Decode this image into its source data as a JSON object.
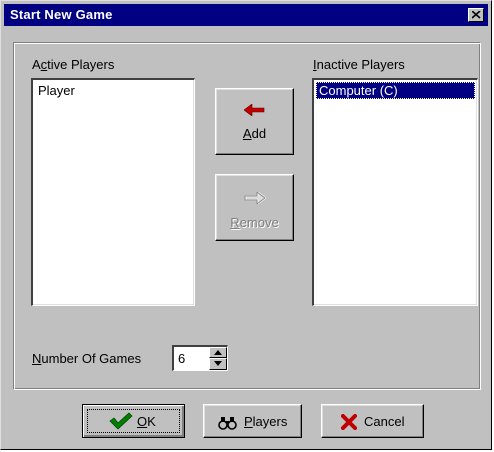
{
  "window": {
    "title": "Start New Game"
  },
  "active": {
    "label_prefix": "A",
    "label_ul": "c",
    "label_rest": "tive Players",
    "items": [
      "Player"
    ]
  },
  "inactive": {
    "label_ul": "I",
    "label_rest": "nactive Players",
    "items": [
      "Computer (C)"
    ],
    "selected_index": 0
  },
  "buttons": {
    "add": {
      "ul": "A",
      "rest": "dd",
      "icon": "left-arrow-icon",
      "color": "#c00000"
    },
    "remove": {
      "ul": "R",
      "rest": "emove",
      "icon": "right-arrow-icon",
      "enabled": false
    },
    "ok": {
      "ul": "O",
      "rest": "K",
      "icon": "checkmark-icon",
      "color": "#008000"
    },
    "players": {
      "ul": "P",
      "rest": "layers",
      "icon": "binoculars-icon"
    },
    "cancel": {
      "label": "Cancel",
      "icon": "x-icon",
      "color": "#c00000"
    }
  },
  "games": {
    "label_ul": "N",
    "label_rest": "umber Of Games",
    "value": "6"
  }
}
